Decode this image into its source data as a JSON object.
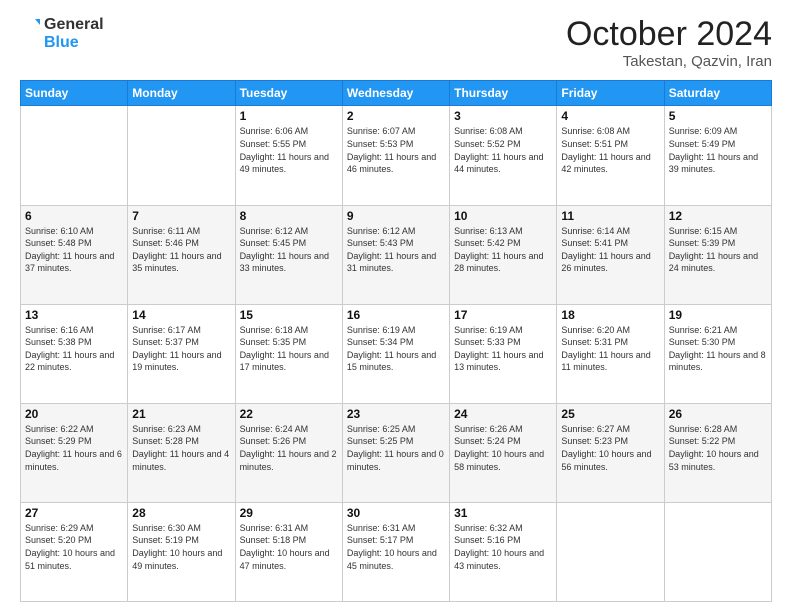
{
  "logo": {
    "line1": "General",
    "line2": "Blue"
  },
  "header": {
    "month": "October 2024",
    "location": "Takestan, Qazvin, Iran"
  },
  "weekdays": [
    "Sunday",
    "Monday",
    "Tuesday",
    "Wednesday",
    "Thursday",
    "Friday",
    "Saturday"
  ],
  "weeks": [
    [
      null,
      null,
      {
        "day": 1,
        "sunrise": "Sunrise: 6:06 AM",
        "sunset": "Sunset: 5:55 PM",
        "daylight": "Daylight: 11 hours and 49 minutes."
      },
      {
        "day": 2,
        "sunrise": "Sunrise: 6:07 AM",
        "sunset": "Sunset: 5:53 PM",
        "daylight": "Daylight: 11 hours and 46 minutes."
      },
      {
        "day": 3,
        "sunrise": "Sunrise: 6:08 AM",
        "sunset": "Sunset: 5:52 PM",
        "daylight": "Daylight: 11 hours and 44 minutes."
      },
      {
        "day": 4,
        "sunrise": "Sunrise: 6:08 AM",
        "sunset": "Sunset: 5:51 PM",
        "daylight": "Daylight: 11 hours and 42 minutes."
      },
      {
        "day": 5,
        "sunrise": "Sunrise: 6:09 AM",
        "sunset": "Sunset: 5:49 PM",
        "daylight": "Daylight: 11 hours and 39 minutes."
      }
    ],
    [
      {
        "day": 6,
        "sunrise": "Sunrise: 6:10 AM",
        "sunset": "Sunset: 5:48 PM",
        "daylight": "Daylight: 11 hours and 37 minutes."
      },
      {
        "day": 7,
        "sunrise": "Sunrise: 6:11 AM",
        "sunset": "Sunset: 5:46 PM",
        "daylight": "Daylight: 11 hours and 35 minutes."
      },
      {
        "day": 8,
        "sunrise": "Sunrise: 6:12 AM",
        "sunset": "Sunset: 5:45 PM",
        "daylight": "Daylight: 11 hours and 33 minutes."
      },
      {
        "day": 9,
        "sunrise": "Sunrise: 6:12 AM",
        "sunset": "Sunset: 5:43 PM",
        "daylight": "Daylight: 11 hours and 31 minutes."
      },
      {
        "day": 10,
        "sunrise": "Sunrise: 6:13 AM",
        "sunset": "Sunset: 5:42 PM",
        "daylight": "Daylight: 11 hours and 28 minutes."
      },
      {
        "day": 11,
        "sunrise": "Sunrise: 6:14 AM",
        "sunset": "Sunset: 5:41 PM",
        "daylight": "Daylight: 11 hours and 26 minutes."
      },
      {
        "day": 12,
        "sunrise": "Sunrise: 6:15 AM",
        "sunset": "Sunset: 5:39 PM",
        "daylight": "Daylight: 11 hours and 24 minutes."
      }
    ],
    [
      {
        "day": 13,
        "sunrise": "Sunrise: 6:16 AM",
        "sunset": "Sunset: 5:38 PM",
        "daylight": "Daylight: 11 hours and 22 minutes."
      },
      {
        "day": 14,
        "sunrise": "Sunrise: 6:17 AM",
        "sunset": "Sunset: 5:37 PM",
        "daylight": "Daylight: 11 hours and 19 minutes."
      },
      {
        "day": 15,
        "sunrise": "Sunrise: 6:18 AM",
        "sunset": "Sunset: 5:35 PM",
        "daylight": "Daylight: 11 hours and 17 minutes."
      },
      {
        "day": 16,
        "sunrise": "Sunrise: 6:19 AM",
        "sunset": "Sunset: 5:34 PM",
        "daylight": "Daylight: 11 hours and 15 minutes."
      },
      {
        "day": 17,
        "sunrise": "Sunrise: 6:19 AM",
        "sunset": "Sunset: 5:33 PM",
        "daylight": "Daylight: 11 hours and 13 minutes."
      },
      {
        "day": 18,
        "sunrise": "Sunrise: 6:20 AM",
        "sunset": "Sunset: 5:31 PM",
        "daylight": "Daylight: 11 hours and 11 minutes."
      },
      {
        "day": 19,
        "sunrise": "Sunrise: 6:21 AM",
        "sunset": "Sunset: 5:30 PM",
        "daylight": "Daylight: 11 hours and 8 minutes."
      }
    ],
    [
      {
        "day": 20,
        "sunrise": "Sunrise: 6:22 AM",
        "sunset": "Sunset: 5:29 PM",
        "daylight": "Daylight: 11 hours and 6 minutes."
      },
      {
        "day": 21,
        "sunrise": "Sunrise: 6:23 AM",
        "sunset": "Sunset: 5:28 PM",
        "daylight": "Daylight: 11 hours and 4 minutes."
      },
      {
        "day": 22,
        "sunrise": "Sunrise: 6:24 AM",
        "sunset": "Sunset: 5:26 PM",
        "daylight": "Daylight: 11 hours and 2 minutes."
      },
      {
        "day": 23,
        "sunrise": "Sunrise: 6:25 AM",
        "sunset": "Sunset: 5:25 PM",
        "daylight": "Daylight: 11 hours and 0 minutes."
      },
      {
        "day": 24,
        "sunrise": "Sunrise: 6:26 AM",
        "sunset": "Sunset: 5:24 PM",
        "daylight": "Daylight: 10 hours and 58 minutes."
      },
      {
        "day": 25,
        "sunrise": "Sunrise: 6:27 AM",
        "sunset": "Sunset: 5:23 PM",
        "daylight": "Daylight: 10 hours and 56 minutes."
      },
      {
        "day": 26,
        "sunrise": "Sunrise: 6:28 AM",
        "sunset": "Sunset: 5:22 PM",
        "daylight": "Daylight: 10 hours and 53 minutes."
      }
    ],
    [
      {
        "day": 27,
        "sunrise": "Sunrise: 6:29 AM",
        "sunset": "Sunset: 5:20 PM",
        "daylight": "Daylight: 10 hours and 51 minutes."
      },
      {
        "day": 28,
        "sunrise": "Sunrise: 6:30 AM",
        "sunset": "Sunset: 5:19 PM",
        "daylight": "Daylight: 10 hours and 49 minutes."
      },
      {
        "day": 29,
        "sunrise": "Sunrise: 6:31 AM",
        "sunset": "Sunset: 5:18 PM",
        "daylight": "Daylight: 10 hours and 47 minutes."
      },
      {
        "day": 30,
        "sunrise": "Sunrise: 6:31 AM",
        "sunset": "Sunset: 5:17 PM",
        "daylight": "Daylight: 10 hours and 45 minutes."
      },
      {
        "day": 31,
        "sunrise": "Sunrise: 6:32 AM",
        "sunset": "Sunset: 5:16 PM",
        "daylight": "Daylight: 10 hours and 43 minutes."
      },
      null,
      null
    ]
  ]
}
